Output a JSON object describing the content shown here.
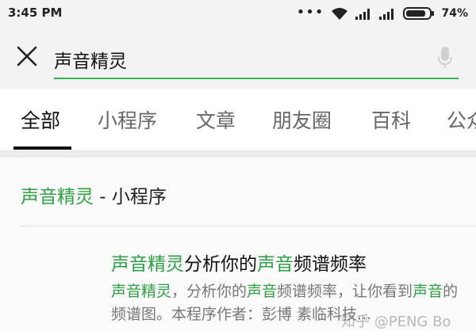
{
  "status_bar": {
    "time": "3:45 PM",
    "more_glyph": "•••",
    "battery_percent": "74%"
  },
  "search": {
    "query": "声音精灵",
    "accent_color": "#35b44a",
    "left_icon": "close-icon",
    "right_icon": "mic-icon"
  },
  "tabs": [
    {
      "label": "全部",
      "active": true
    },
    {
      "label": "小程序",
      "active": false
    },
    {
      "label": "文章",
      "active": false
    },
    {
      "label": "朋友圈",
      "active": false
    },
    {
      "label": "百科",
      "active": false
    },
    {
      "label": "公众",
      "active": false
    }
  ],
  "section": {
    "highlight": "声音精灵",
    "rest": " - 小程序"
  },
  "result": {
    "title_highlight_1": "声音精灵",
    "title_plain_1": "分析你的",
    "title_highlight_2": "声音",
    "title_plain_2": "频谱频率",
    "snippet_hl_1": "声音精灵",
    "snippet_plain_1": "，分析你的",
    "snippet_hl_2": "声音",
    "snippet_plain_2": "频谱频率，让你看到",
    "snippet_hl_3": "声音",
    "snippet_plain_3": "的频谱图。本程序作者：彭博 素临科技..."
  },
  "watermark": "知乎 @PENG Bo",
  "colors": {
    "highlight_green": "#2e9f44",
    "wave_teal": "#5ecfc0",
    "wave_blue": "#3b7bd1"
  }
}
